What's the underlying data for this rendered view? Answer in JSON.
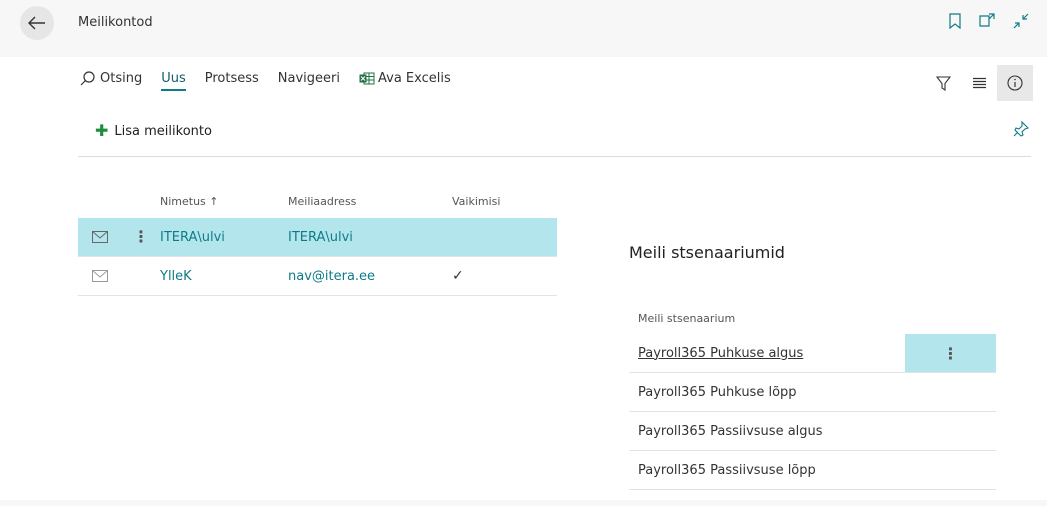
{
  "header": {
    "title": "Meilikontod"
  },
  "actionbar": {
    "search": "Otsing",
    "new": "Uus",
    "process": "Protsess",
    "navigate": "Navigeeri",
    "excel": "Ava Excelis",
    "add_account": "Lisa meilikonto"
  },
  "accounts": {
    "headers": {
      "name": "Nimetus ↑",
      "email": "Meiliaadress",
      "default": "Vaikimisi"
    },
    "rows": [
      {
        "name": "ITERA\\ulvi",
        "email": "ITERA\\ulvi",
        "default": ""
      },
      {
        "name": "YlleK",
        "email": "nav@itera.ee",
        "default": "✓"
      }
    ]
  },
  "scenarios": {
    "title": "Meili stsenaariumid",
    "header": "Meili stsenaarium",
    "rows": [
      "Payroll365 Puhkuse algus",
      "Payroll365 Puhkuse lõpp",
      "Payroll365 Passiivsuse algus",
      "Payroll365 Passiivsuse lõpp"
    ]
  },
  "colors": {
    "accent": "#0e7c86",
    "selection": "#b3e6ec",
    "add_green": "#1e8c3a"
  }
}
